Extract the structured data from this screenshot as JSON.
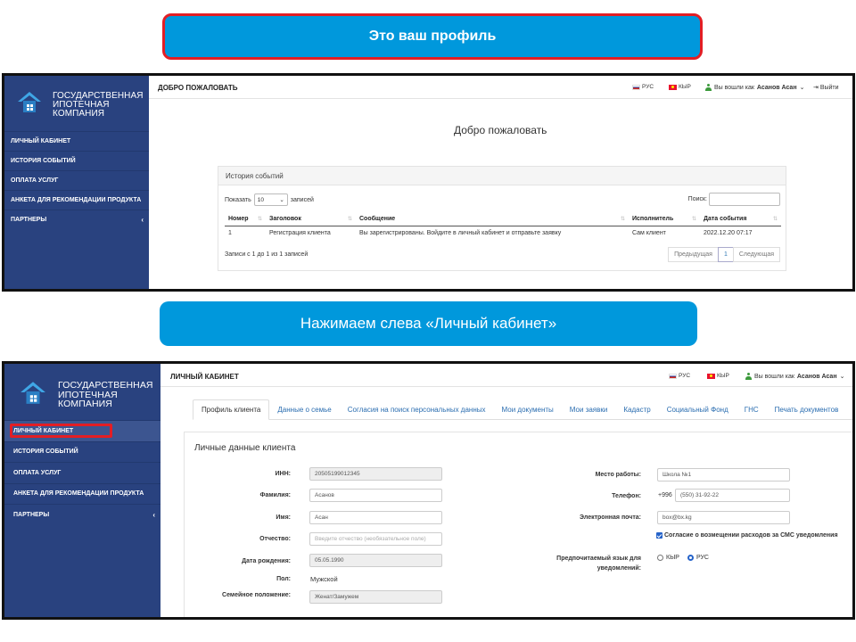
{
  "callouts": {
    "first": "Это ваш профиль",
    "second": "Нажимаем слева «Личный кабинет»"
  },
  "brand": {
    "line1": "Государственная",
    "line2": "ипотечная",
    "line3": "компания",
    "logo_icon": "house-logo-icon"
  },
  "sidebar": {
    "items": [
      {
        "label": "Личный кабинет"
      },
      {
        "label": "История событий"
      },
      {
        "label": "Оплата услуг"
      },
      {
        "label": "Анкета для рекомендации продукта"
      },
      {
        "label": "Партнеры"
      }
    ],
    "expand_icon": "‹"
  },
  "header": {
    "lang_ru": "РУС",
    "lang_kg": "КЫР",
    "logged_in_prefix": "Вы вошли как",
    "user_name": "Асанов Асан",
    "logout_label": "Выйти"
  },
  "screen1": {
    "top_title": "Добро пожаловать",
    "welcome": "Добро пожаловать",
    "panel_title": "История событий",
    "length_prefix": "Показать",
    "length_value": "10",
    "length_suffix": "записей",
    "search_label": "Поиск:",
    "columns": [
      "Номер",
      "Заголовок",
      "Сообщение",
      "Исполнитель",
      "Дата события"
    ],
    "rows": [
      [
        "1",
        "Регистрация клиента",
        "Вы зарегистрированы. Войдите в личный кабинет и отправьте заявку",
        "Сам клиент",
        "2022.12.20 07:17"
      ]
    ],
    "info": "Записи с 1 до 1 из 1 записей",
    "pager": {
      "prev": "Предыдущая",
      "current": "1",
      "next": "Следующая"
    }
  },
  "screen2": {
    "top_title": "Личный кабинет",
    "tabs": [
      "Профиль клиента",
      "Данные о семье",
      "Согласия на поиск персональных данных",
      "Мои документы",
      "Мои заявки",
      "Кадастр",
      "Социальный Фонд",
      "ГНС",
      "Печать документов"
    ],
    "card_title": "Личные данные клиента",
    "fields": {
      "inn_label": "ИНН:",
      "inn_value": "20505199012345",
      "surname_label": "Фамилия:",
      "surname_value": "Асанов",
      "name_label": "Имя:",
      "name_value": "Асан",
      "patronymic_label": "Отчество:",
      "patronymic_placeholder": "Введите отчество (необязательное поле)",
      "birth_label": "Дата рождения:",
      "birth_value": "05.05.1990",
      "gender_label": "Пол:",
      "gender_value": "Мужской",
      "marital_label": "Семейное положение:",
      "marital_value": "Женат/Замужем",
      "work_label": "Место работы:",
      "work_value": "Школа №1",
      "phone_label": "Телефон:",
      "phone_prefix": "+996",
      "phone_value": "(550) 31-92-22",
      "email_label": "Электронная почта:",
      "email_value": "box@bx.kg",
      "sms_consent": "Согласие о возмещении расходов за СМС уведомления",
      "sms_consent_checked": true,
      "lang_pref_label_1": "Предпочитаемый язык для",
      "lang_pref_label_2": "уведомлений:",
      "lang_option_kg": "КЫР",
      "lang_option_ru": "РУС",
      "lang_selected": "РУС"
    }
  },
  "colors": {
    "sidebar": "#29427f",
    "callout": "#0098dc",
    "highlight": "#e31e24"
  }
}
